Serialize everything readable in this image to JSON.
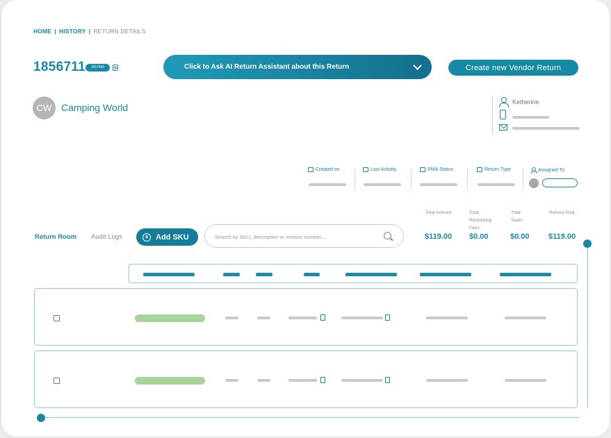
{
  "breadcrumb": {
    "items": [
      "HOME",
      "HISTORY",
      "RETURN DETAILS"
    ],
    "separator": "|"
  },
  "header": {
    "return_id": "1856711",
    "id_badge": "1557660",
    "ai_button_label": "Click to Ask AI Return Assistant about this Return",
    "vendor_button_label": "Create new Vendor Return"
  },
  "customer": {
    "initials": "CW",
    "name": "Camping World"
  },
  "contact": {
    "name": "Ketherine"
  },
  "meta": {
    "created_on": "Created on",
    "last_activity": "Last Activity",
    "rma_status": "RMA Status",
    "return_type": "Return Type",
    "assigned_to": "Assigned To"
  },
  "totals": [
    {
      "label": "Total Amount",
      "value": "$119.00"
    },
    {
      "label": "Total Restocking Fees",
      "value": "$0.00"
    },
    {
      "label": "Total Taxes",
      "value": "$0.00"
    },
    {
      "label": "Refund Total",
      "value": "$119.00"
    }
  ],
  "tabs": {
    "active": "Return Room",
    "inactive": "Audit Logs"
  },
  "add_sku_label": "Add SKU",
  "search": {
    "placeholder": "Search by SKU, description or invoice number..."
  },
  "colors": {
    "accent": "#1689a4",
    "pill_green": "#a6d49a",
    "placeholder": "#c9c9c9"
  },
  "icons": [
    "copy-icon",
    "chevron-down-icon",
    "person-icon",
    "phone-icon",
    "mail-icon",
    "calendar-icon",
    "checkbox-icon",
    "user-icon",
    "plus-circle-icon",
    "search-icon",
    "document-icon"
  ]
}
